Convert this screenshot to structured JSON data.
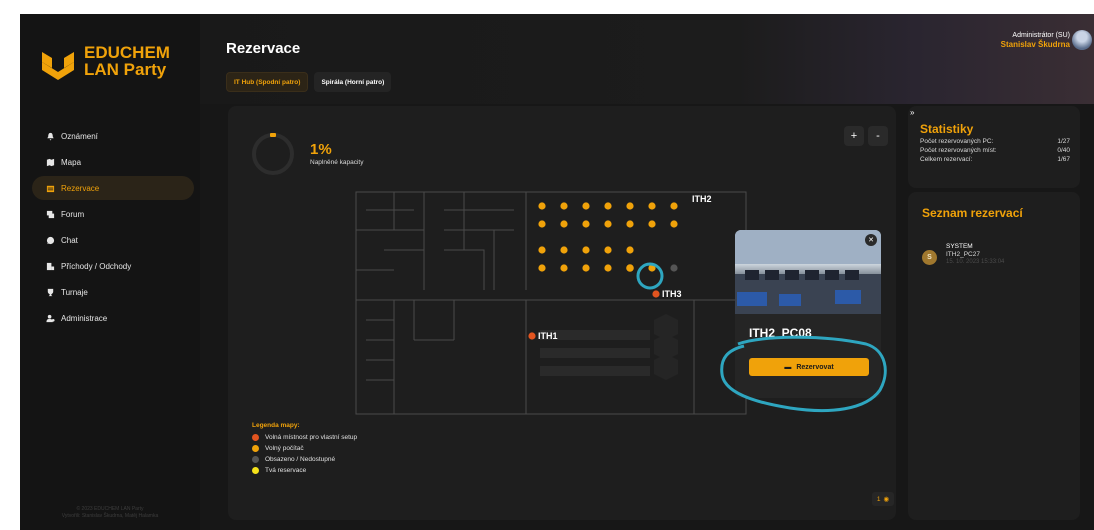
{
  "app": {
    "brand_line1": "EDUCHEM",
    "brand_line2": "LAN Party",
    "footer": "© 2023 EDUCHEM LAN Party\nVytvořili: Stanislav Škudrna, Matěj Halamka"
  },
  "colors": {
    "accent": "#f0a20a",
    "free_room": "#e2541f",
    "free_pc": "#f0a20a",
    "occupied": "#555555",
    "your_reservation": "#f5e21b",
    "annotation": "#2ea6c0"
  },
  "sidebar": {
    "items": [
      {
        "label": "Oznámení",
        "icon": "bell-icon"
      },
      {
        "label": "Mapa",
        "icon": "map-icon"
      },
      {
        "label": "Rezervace",
        "icon": "calendar-icon",
        "active": true
      },
      {
        "label": "Forum",
        "icon": "forum-icon"
      },
      {
        "label": "Chat",
        "icon": "chat-icon"
      },
      {
        "label": "Příchody / Odchody",
        "icon": "arrivals-icon"
      },
      {
        "label": "Turnaje",
        "icon": "trophy-icon"
      },
      {
        "label": "Administrace",
        "icon": "admin-icon"
      }
    ]
  },
  "header": {
    "title": "Rezervace",
    "tabs": [
      "IT Hub (Spodní patro)",
      "Spirála (Horní patro)"
    ]
  },
  "user": {
    "role": "Administrátor (SU)",
    "name": "Stanislav Škudrna"
  },
  "map": {
    "capacity_value": "1%",
    "capacity_label": "Naplněné kapacity",
    "capacity_fraction": 0.01,
    "zoom_in": "+",
    "zoom_out": "-",
    "rooms": [
      "ITH2",
      "ITH3",
      "ITH1"
    ],
    "legend_title": "Legenda mapy:",
    "legend": [
      {
        "label": "Volná místnost pro vlastní setup",
        "color": "#e2541f"
      },
      {
        "label": "Volný počítač",
        "color": "#f0a20a"
      },
      {
        "label": "Obsazeno / Nedostupné",
        "color": "#555555"
      },
      {
        "label": "Tvá reservace",
        "color": "#f5e21b"
      }
    ],
    "viewers_count": "1"
  },
  "popup": {
    "pc_name": "ITH2_PC08",
    "reserve_label": "Rezervovat"
  },
  "stats": {
    "title": "Statistiky",
    "rows": [
      {
        "label": "Počet rezervovaných PC:",
        "value": "1/27"
      },
      {
        "label": "Počet rezervovaných míst:",
        "value": "0/40"
      },
      {
        "label": "Celkem rezervací:",
        "value": "1/67"
      }
    ]
  },
  "reservations": {
    "title": "Seznam rezervací",
    "items": [
      {
        "initial": "S",
        "user": "SYSTEM",
        "pc": "ITH2_PC27",
        "date": "15. 10. 2023 15:33:04"
      }
    ]
  }
}
